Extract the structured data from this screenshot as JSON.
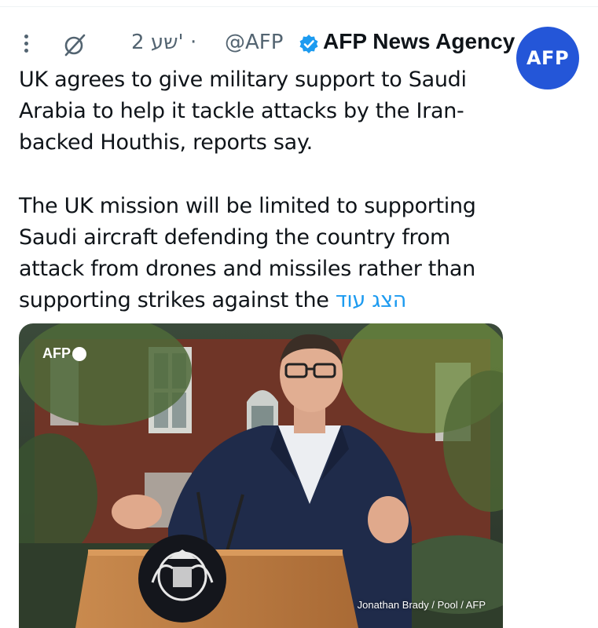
{
  "tweet": {
    "author": {
      "display_name": "AFP News Agency",
      "handle": "@AFP",
      "avatar_text": "AFP",
      "verified": true
    },
    "time_label": "2 שע'",
    "separator": "·",
    "text_paragraphs": [
      "UK agrees to give military support to Saudi Arabia to help it tackle attacks by the Iran-backed Houthis, reports say.",
      "The UK mission will be limited to supporting Saudi aircraft defending the country from attack from drones and missiles rather than supporting strikes against the"
    ],
    "show_more_label": "הצג עוד",
    "media": {
      "watermark": "AFP",
      "credit": "Jonathan Brady / Pool / AFP"
    }
  },
  "icons": {
    "more": "more-vertical-icon",
    "grok": "grok-icon",
    "verified": "verified-badge-icon"
  },
  "colors": {
    "accent": "#1d9bf0",
    "avatar_bg": "#2456d8",
    "text": "#0f1419",
    "secondary_text": "#536471"
  }
}
